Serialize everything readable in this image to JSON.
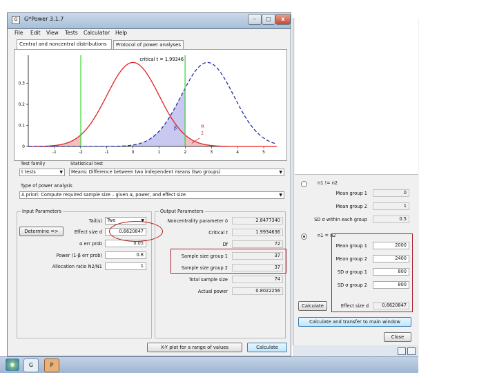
{
  "window": {
    "title": "G*Power 3.1.7",
    "icon": "gpower-icon",
    "minimize": "–",
    "maximize": "□",
    "close": "x"
  },
  "menu": [
    "File",
    "Edit",
    "View",
    "Tests",
    "Calculator",
    "Help"
  ],
  "tabs": [
    "Central and noncentral distributions",
    "Protocol of power analyses"
  ],
  "chart_data": {
    "type": "line",
    "title": "critical t = 1.99346",
    "xticks": [
      "-1",
      "-2",
      "-1",
      "0",
      "1",
      "2",
      "3",
      "4",
      "5"
    ],
    "yticks": [
      "0",
      "0.1",
      "0.2",
      "0.3"
    ],
    "xlim": [
      -4,
      5.5
    ],
    "ylim": [
      0,
      0.42
    ],
    "series": [
      {
        "name": "central",
        "color": "#e02020",
        "style": "solid",
        "mean": 0,
        "sd": 1
      },
      {
        "name": "noncentral",
        "color": "#1f2f9e",
        "style": "dashed",
        "mean": 2.85,
        "sd": 1
      }
    ],
    "critical_lines": [
      -1.99346,
      1.99346
    ],
    "critical_color": "#2bd62b",
    "annotations": {
      "beta": "β",
      "alpha": "α",
      "alpha_denominator": "2"
    }
  },
  "test_family": {
    "label": "Test family",
    "value": "t tests"
  },
  "statistical_test": {
    "label": "Statistical test",
    "value": "Means: Difference between two independent means (two groups)"
  },
  "power_analysis": {
    "label": "Type of power analysis",
    "value": "A priori: Compute required sample size – given α, power, and effect size"
  },
  "input": {
    "title": "Input Parameters",
    "determine_button": "Determine =>",
    "tails_label": "Tail(s)",
    "tails_value": "Two",
    "effect_label": "Effect size d",
    "effect_value": "0.6620847",
    "alpha_label": "α err prob",
    "alpha_value": "0.05",
    "power_label": "Power (1-β err prob)",
    "power_value": "0.8",
    "ratio_label": "Allocation ratio N2/N1",
    "ratio_value": "1"
  },
  "output": {
    "title": "Output Parameters",
    "rows": [
      {
        "label": "Noncentrality parameter δ",
        "value": "2.8477340"
      },
      {
        "label": "Critical t",
        "value": "1.9934636"
      },
      {
        "label": "Df",
        "value": "72"
      },
      {
        "label": "Sample size group 1",
        "value": "37"
      },
      {
        "label": "Sample size group 2",
        "value": "37"
      },
      {
        "label": "Total sample size",
        "value": "74"
      },
      {
        "label": "Actual power",
        "value": "0.8022256"
      }
    ]
  },
  "bottom_buttons": {
    "xy_plot": "X-Y plot for a range of values",
    "calculate": "Calculate"
  },
  "effect_panel": {
    "radio1": "n1 != n2",
    "top_rows": [
      {
        "label": "Mean group 1",
        "value": "0"
      },
      {
        "label": "Mean group 2",
        "value": "1"
      },
      {
        "label": "SD σ within each group",
        "value": "0.5"
      }
    ],
    "radio2": "n1 = n2",
    "bottom_rows": [
      {
        "label": "Mean group 1",
        "value": "2000"
      },
      {
        "label": "Mean group 2",
        "value": "2400"
      },
      {
        "label": "SD σ group 1",
        "value": "800"
      },
      {
        "label": "SD σ group 2",
        "value": "800"
      }
    ],
    "calc_button": "Calculate",
    "effect_label": "Effect size d",
    "effect_value": "0.6620847",
    "transfer_button": "Calculate and transfer to main window",
    "close_button": "Close"
  },
  "accent": "#a2202a"
}
